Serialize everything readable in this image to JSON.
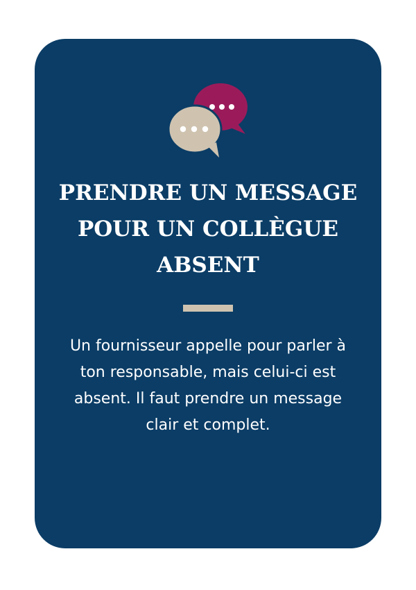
{
  "card": {
    "title": "PRENDRE UN MESSAGE POUR UN COLLÈGUE ABSENT",
    "body": "Un fournisseur appelle pour parler à ton responsable, mais celui-ci est absent. Il faut prendre un message clair et complet."
  },
  "icon": {
    "name": "chat-bubbles-icon"
  },
  "colors": {
    "card_background": "#0b3d66",
    "bubble_back": "#9b1b5a",
    "bubble_front": "#cfc3b0",
    "divider": "#cfc3b0",
    "text": "#ffffff"
  }
}
